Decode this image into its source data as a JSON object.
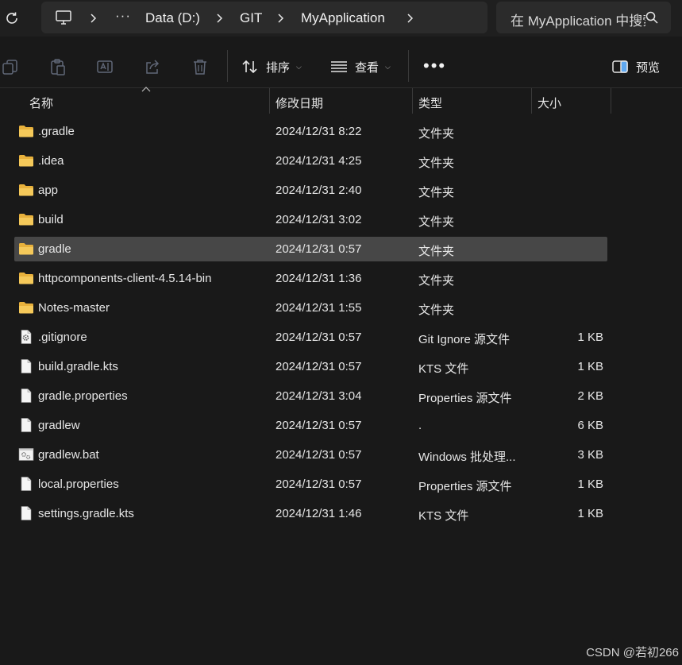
{
  "breadcrumb": {
    "more": "···",
    "items": [
      "Data (D:)",
      "GIT",
      "MyApplication"
    ]
  },
  "search": {
    "placeholder": "在 MyApplication 中搜索"
  },
  "toolbar": {
    "sort_label": "排序",
    "view_label": "查看",
    "more": "•••",
    "preview_label": "预览"
  },
  "columns": {
    "name": "名称",
    "date": "修改日期",
    "type": "类型",
    "size": "大小"
  },
  "files": [
    {
      "name": ".gradle",
      "date": "2024/12/31 8:22",
      "type": "文件夹",
      "size": "",
      "icon": "folder-icon"
    },
    {
      "name": ".idea",
      "date": "2024/12/31 4:25",
      "type": "文件夹",
      "size": "",
      "icon": "folder-icon"
    },
    {
      "name": "app",
      "date": "2024/12/31 2:40",
      "type": "文件夹",
      "size": "",
      "icon": "folder-icon"
    },
    {
      "name": "build",
      "date": "2024/12/31 3:02",
      "type": "文件夹",
      "size": "",
      "icon": "folder-icon"
    },
    {
      "name": "gradle",
      "date": "2024/12/31 0:57",
      "type": "文件夹",
      "size": "",
      "icon": "folder-icon",
      "selected": true
    },
    {
      "name": "httpcomponents-client-4.5.14-bin",
      "date": "2024/12/31 1:36",
      "type": "文件夹",
      "size": "",
      "icon": "folder-icon"
    },
    {
      "name": "Notes-master",
      "date": "2024/12/31 1:55",
      "type": "文件夹",
      "size": "",
      "icon": "folder-icon"
    },
    {
      "name": ".gitignore",
      "date": "2024/12/31 0:57",
      "type": "Git Ignore 源文件",
      "size": "1 KB",
      "icon": "settings-file-icon"
    },
    {
      "name": "build.gradle.kts",
      "date": "2024/12/31 0:57",
      "type": "KTS 文件",
      "size": "1 KB",
      "icon": "file-icon"
    },
    {
      "name": "gradle.properties",
      "date": "2024/12/31 3:04",
      "type": "Properties 源文件",
      "size": "2 KB",
      "icon": "file-icon"
    },
    {
      "name": "gradlew",
      "date": "2024/12/31 0:57",
      "type": ".",
      "size": "6 KB",
      "icon": "file-icon"
    },
    {
      "name": "gradlew.bat",
      "date": "2024/12/31 0:57",
      "type": "Windows 批处理...",
      "size": "3 KB",
      "icon": "batch-file-icon"
    },
    {
      "name": "local.properties",
      "date": "2024/12/31 0:57",
      "type": "Properties 源文件",
      "size": "1 KB",
      "icon": "file-icon"
    },
    {
      "name": "settings.gradle.kts",
      "date": "2024/12/31 1:46",
      "type": "KTS 文件",
      "size": "1 KB",
      "icon": "file-icon"
    }
  ],
  "watermark": "CSDN @若初266",
  "colors": {
    "background": "#191919",
    "folder": "#f0c24b",
    "selected_row": "#474747"
  }
}
